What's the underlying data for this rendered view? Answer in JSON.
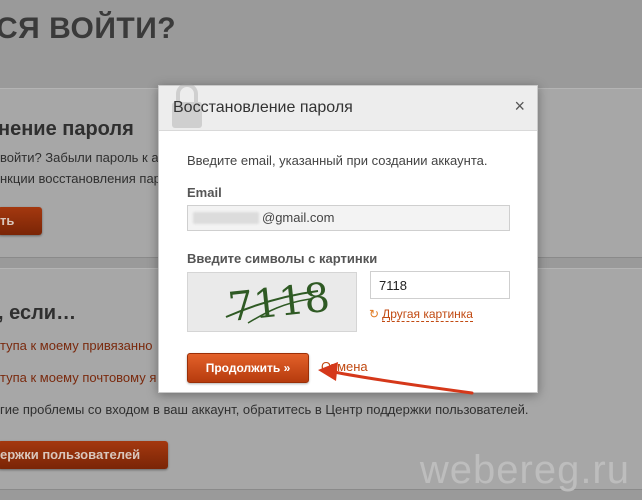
{
  "background": {
    "heading": "СЯ ВОЙТИ?",
    "section1": {
      "title": "нение пароля",
      "line1": "войти? Забыли пароль к а",
      "line2": "нкции восстановления пар",
      "button": "ть"
    },
    "section2": {
      "title": ", если…",
      "link1": "тупа к моему привязанно",
      "link2": "тупа к моему почтовому я",
      "text": "гие проблемы со входом в ваш аккаунт, обратитесь в Центр поддержки пользователей.",
      "button": "ержки пользователей"
    },
    "watermark": "webereg.ru"
  },
  "modal": {
    "title": "Восстановление пароля",
    "close": "×",
    "intro": "Введите email, указанный при создании аккаунта.",
    "email_label": "Email",
    "email_value_visible": "@gmail.com",
    "captcha_label": "Введите символы с картинки",
    "captcha_image_text": "7118",
    "captcha_input_value": "7118",
    "refresh_link": "Другая картинка",
    "continue_button": "Продолжить »",
    "cancel_link": "Отмена"
  },
  "icons": {
    "close": "close-icon",
    "refresh": "refresh-icon",
    "lock": "lock-icon",
    "arrow": "arrow-annotation"
  },
  "colors": {
    "accent": "#c14a12",
    "button": "#d4521c",
    "arrow": "#d5381a"
  }
}
